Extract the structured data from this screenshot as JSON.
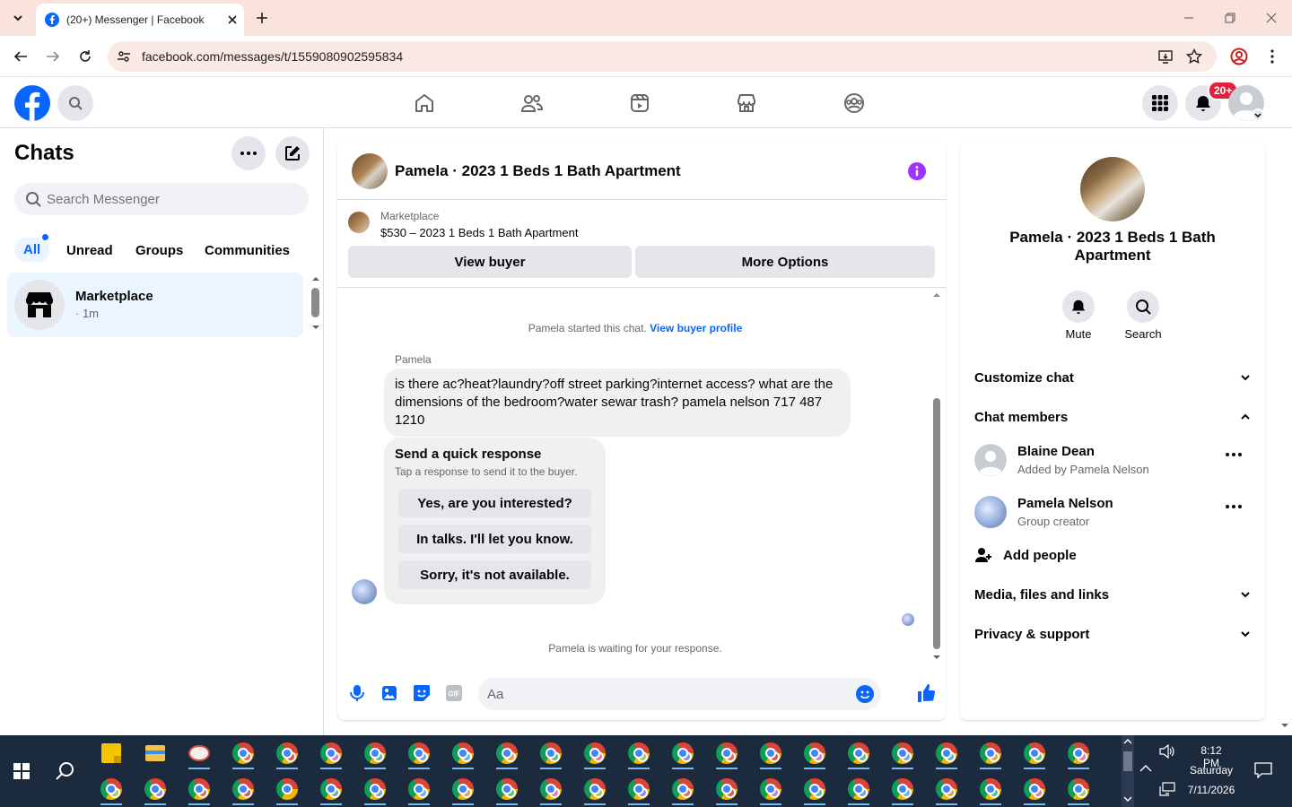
{
  "browser": {
    "tab_title": "(20+) Messenger | Facebook",
    "url": "facebook.com/messages/t/1559080902595834"
  },
  "fb": {
    "notifications_badge": "20+"
  },
  "left": {
    "title": "Chats",
    "search_placeholder": "Search Messenger",
    "filters": [
      "All",
      "Unread",
      "Groups",
      "Communities"
    ],
    "chat": {
      "name": "Marketplace",
      "time": "· 1m"
    }
  },
  "conversation": {
    "title": "Pamela · 2023 1 Beds 1 Bath Apartment",
    "listing_source": "Marketplace",
    "listing_title": "$530 – 2023 1 Beds 1 Bath Apartment",
    "view_buyer_label": "View buyer",
    "more_options_label": "More Options",
    "started_text": "Pamela started this chat.",
    "view_buyer_profile": "View buyer profile",
    "sender_name": "Pamela",
    "message": "is there ac?heat?laundry?off street parking?internet access? what are the dimensions of the bedroom?water sewar trash? pamela nelson 717 487 1210",
    "quick_response_title": "Send a quick response",
    "quick_response_sub": "Tap a response to send it to the buyer.",
    "quick_responses": [
      "Yes, are you interested?",
      "In talks. I'll let you know.",
      "Sorry, it's not available."
    ],
    "waiting_text": "Pamela is waiting for your response.",
    "composer_placeholder": "Aa"
  },
  "details": {
    "name": "Pamela · 2023 1 Beds 1 Bath Apartment",
    "mute_label": "Mute",
    "search_label": "Search",
    "customize": "Customize chat",
    "members_header": "Chat members",
    "members": [
      {
        "name": "Blaine Dean",
        "sub": "Added by Pamela Nelson"
      },
      {
        "name": "Pamela Nelson",
        "sub": "Group creator"
      }
    ],
    "add_people": "Add people",
    "media": "Media, files and links",
    "privacy": "Privacy & support"
  },
  "taskbar": {
    "time": "8:12 PM",
    "day": "Saturday",
    "date": "7/11/2026"
  },
  "colors": {
    "brand": "#0866ff",
    "accent_purple": "#a033ff",
    "badge_red": "#e41e3f"
  }
}
